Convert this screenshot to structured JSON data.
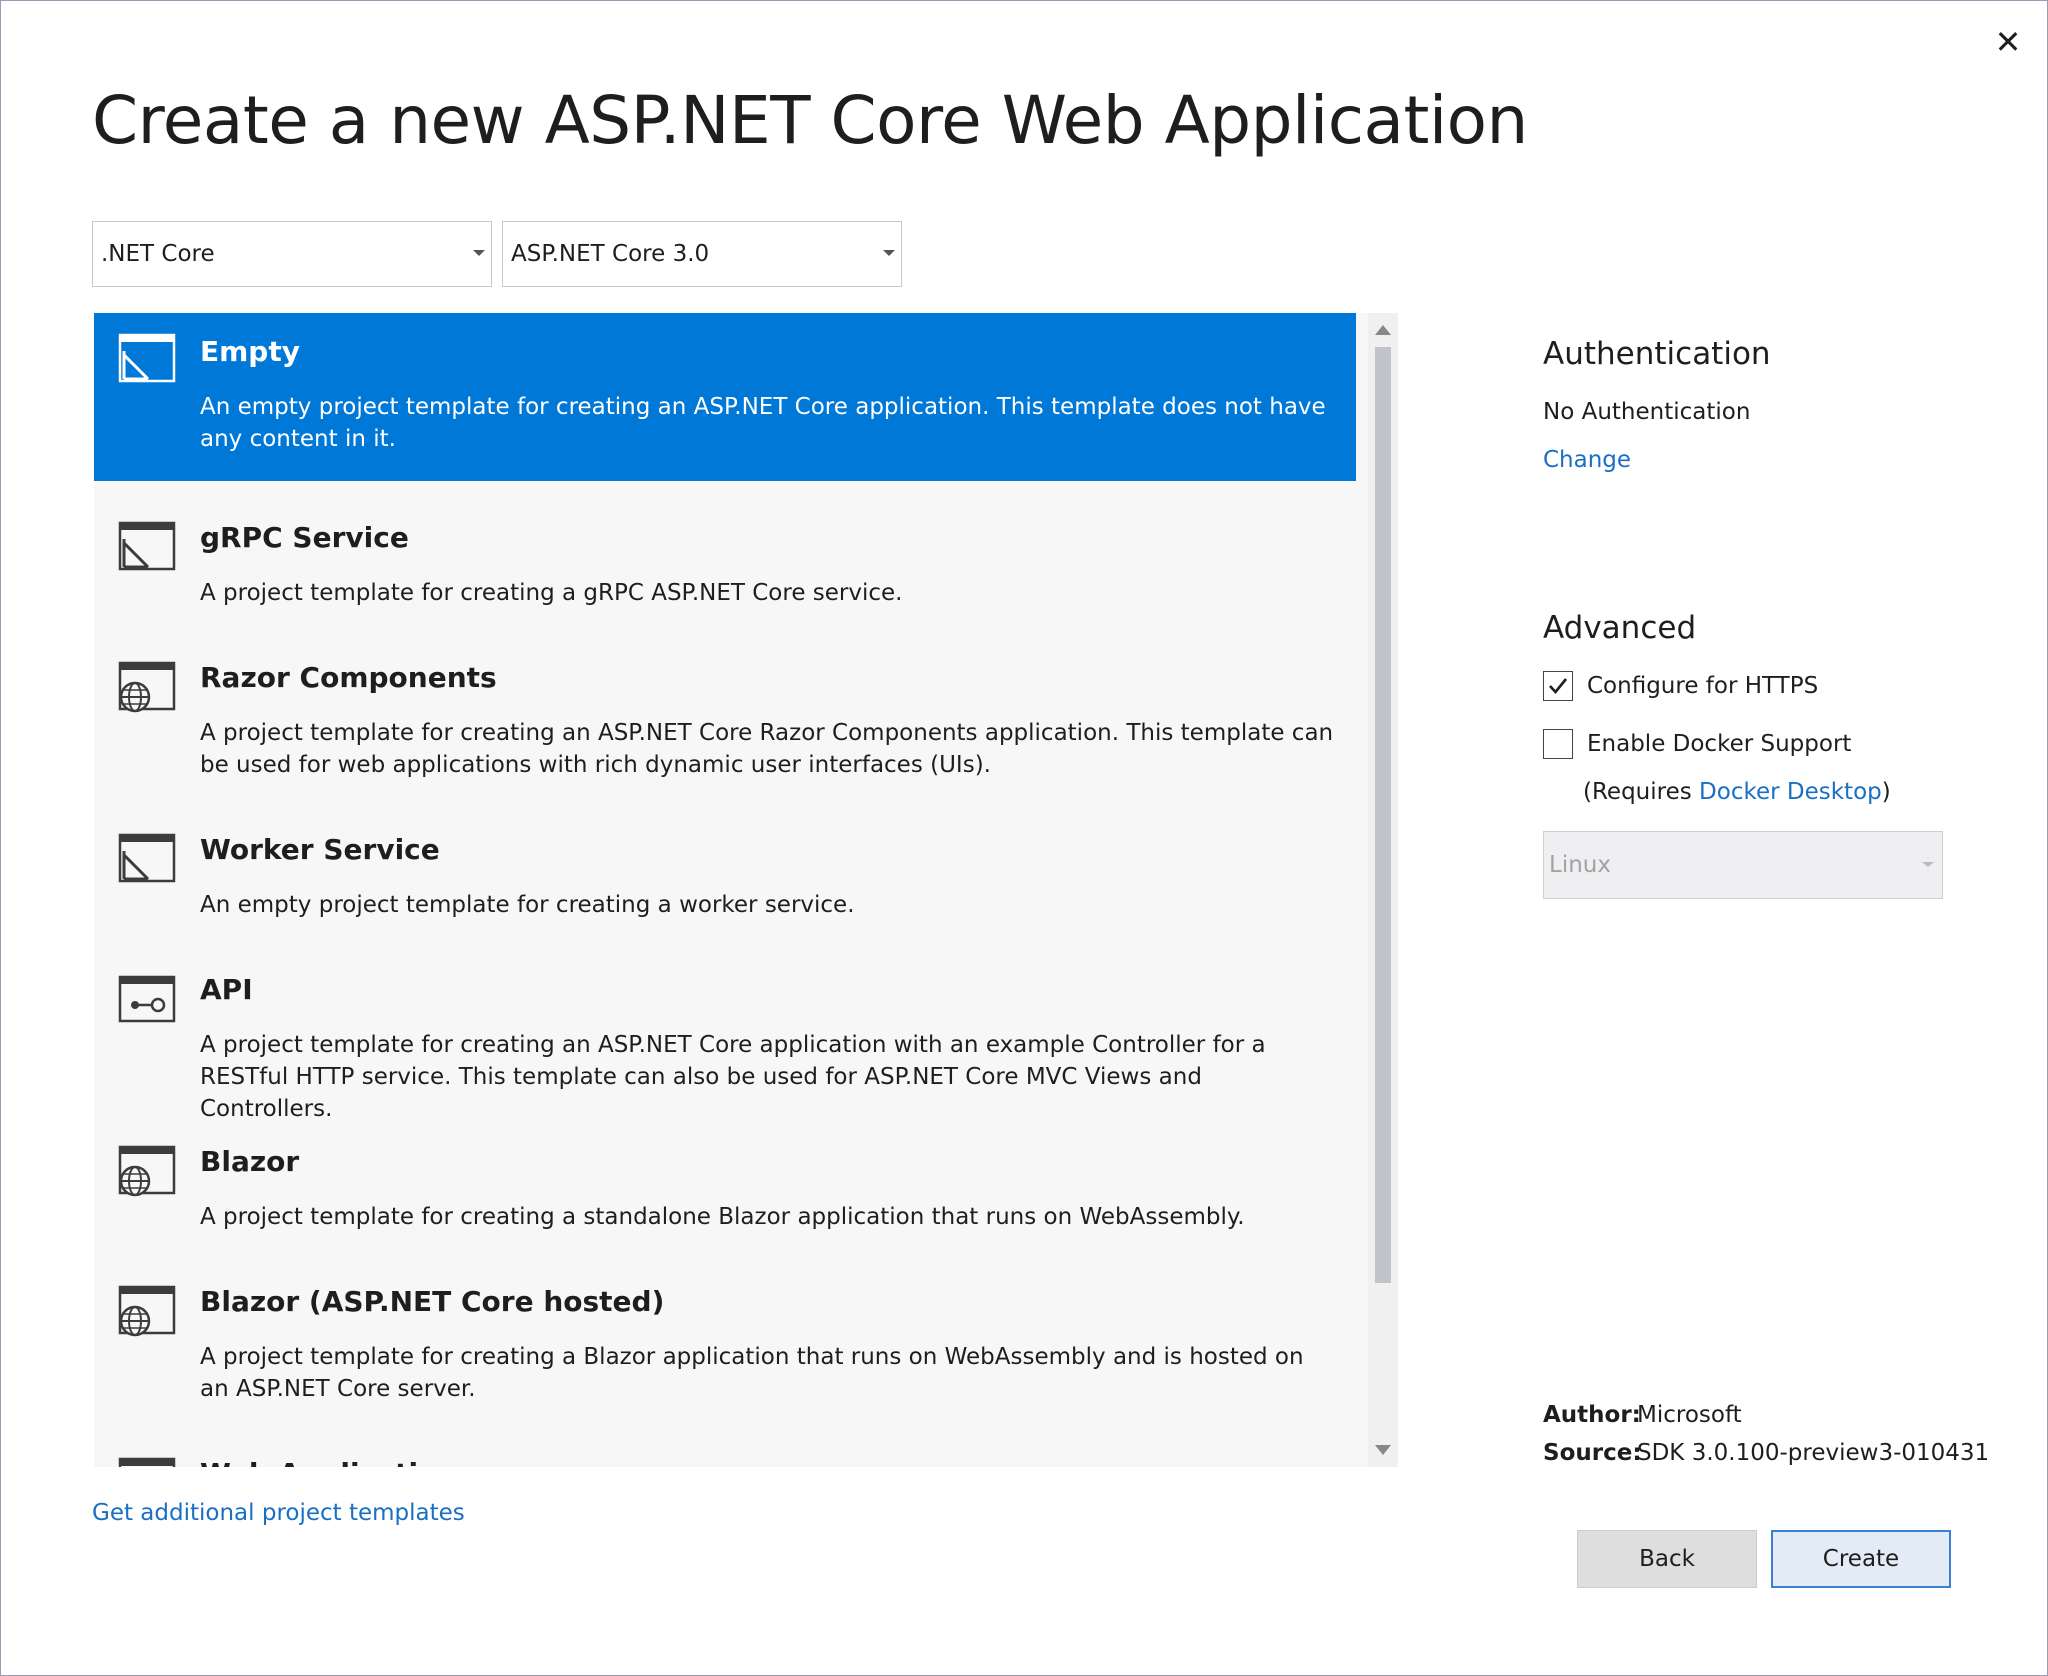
{
  "window": {
    "close_glyph": "✕"
  },
  "title": "Create a new ASP.NET Core Web Application",
  "filters": {
    "framework": ".NET Core",
    "version": "ASP.NET Core 3.0"
  },
  "templates": [
    {
      "name": "Empty",
      "desc": "An empty project template for creating an ASP.NET Core application. This template does not have any content in it.",
      "icon": "empty-template-icon",
      "selected": true
    },
    {
      "name": "gRPC Service",
      "desc": "A project template for creating a gRPC ASP.NET Core service.",
      "icon": "empty-template-icon"
    },
    {
      "name": "Razor Components",
      "desc": "A project template for creating an ASP.NET Core Razor Components application. This template can be used for web applications with rich dynamic user interfaces (UIs).",
      "icon": "globe-template-icon"
    },
    {
      "name": "Worker Service",
      "desc": "An empty project template for creating a worker service.",
      "icon": "empty-template-icon"
    },
    {
      "name": "API",
      "desc": "A project template for creating an ASP.NET Core application with an example Controller for a RESTful HTTP service. This template can also be used for ASP.NET Core MVC Views and Controllers.",
      "icon": "api-template-icon"
    },
    {
      "name": "Blazor",
      "desc": "A project template for creating a standalone Blazor application that runs on WebAssembly.",
      "icon": "globe-template-icon"
    },
    {
      "name": "Blazor (ASP.NET Core hosted)",
      "desc": "A project template for creating a Blazor application that runs on WebAssembly and is hosted on an ASP.NET Core server.",
      "icon": "globe-template-icon"
    },
    {
      "name": "Web Application",
      "desc": "",
      "icon": "globe-template-icon"
    }
  ],
  "authentication": {
    "heading": "Authentication",
    "value": "No Authentication",
    "change_link": "Change"
  },
  "advanced": {
    "heading": "Advanced",
    "https_label": "Configure for HTTPS",
    "https_checked": true,
    "docker_label": "Enable Docker Support",
    "docker_checked": false,
    "requires_prefix": "(Requires ",
    "requires_link": "Docker Desktop",
    "requires_suffix": ")",
    "os_value": "Linux"
  },
  "meta": {
    "author_label": "Author:",
    "author": "Microsoft",
    "source_label": "Source:",
    "source": "SDK 3.0.100-preview3-010431"
  },
  "footer": {
    "get_templates_link": "Get additional project templates",
    "back_label": "Back",
    "create_label": "Create"
  },
  "colors": {
    "accent": "#0078d7",
    "link": "#1a6fc4",
    "list_bg": "#f7f7f7"
  }
}
